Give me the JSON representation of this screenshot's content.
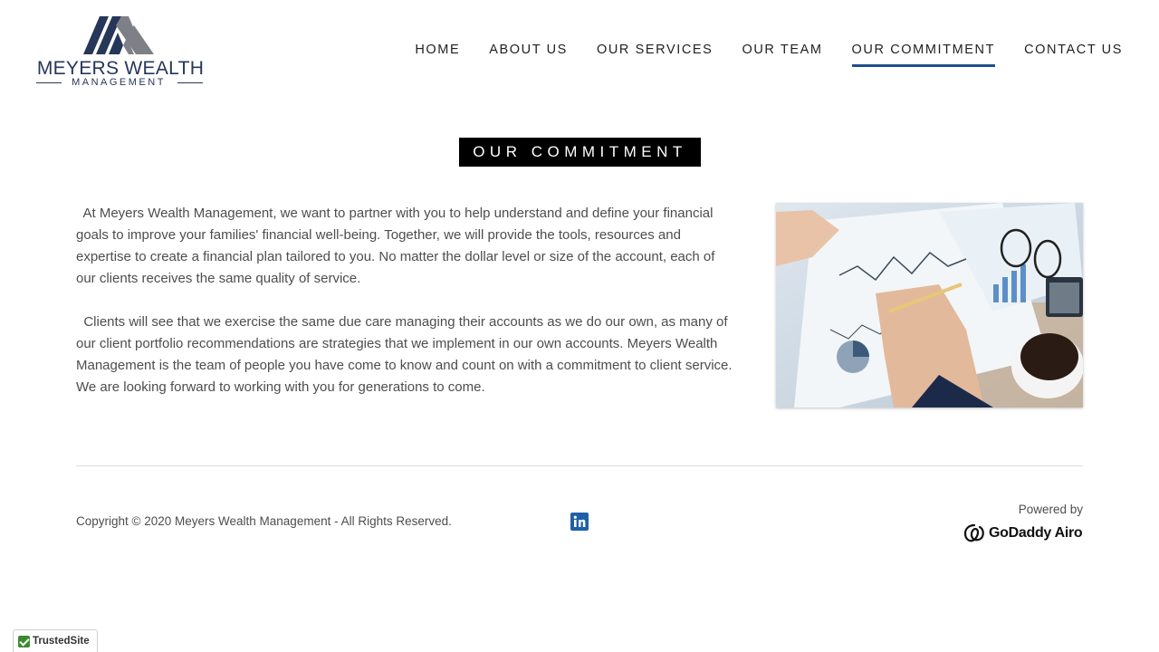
{
  "header": {
    "logo": {
      "name": "MEYERS WEALTH",
      "sub": "MANAGEMENT"
    },
    "nav": [
      {
        "label": "HOME",
        "active": false
      },
      {
        "label": "ABOUT US",
        "active": false
      },
      {
        "label": "OUR SERVICES",
        "active": false
      },
      {
        "label": "OUR TEAM",
        "active": false
      },
      {
        "label": "OUR COMMITMENT",
        "active": true
      },
      {
        "label": "CONTACT US",
        "active": false
      }
    ]
  },
  "main": {
    "title": "OUR COMMITMENT",
    "paragraphs": [
      "  At Meyers Wealth Management, we want to partner with you to help understand and define your financial goals to improve your families' financial well-being. Together, we will provide the tools, resources and expertise to create a financial plan tailored to you. No matter the dollar level or size of the account, each of our clients receives the same quality of service.",
      "  Clients will see that we exercise the same due care managing their accounts as we do our own, as many of our client portfolio recommendations are strategies that we implement in our own accounts. Meyers Wealth Management is the team of people you have come to know and count on with a commitment to client service. We are looking forward to working with you for generations to come."
    ]
  },
  "footer": {
    "copyright": "Copyright © 2020 Meyers Wealth Management - All Rights Reserved.",
    "powered_by": "Powered by",
    "godaddy": "GoDaddy Airo",
    "linkedin_icon": "linkedin-icon"
  },
  "badge": {
    "label": "TrustedSite"
  },
  "colors": {
    "accent": "#1d4e8e",
    "brand_navy": "#27375a",
    "title_bg": "#000000"
  }
}
